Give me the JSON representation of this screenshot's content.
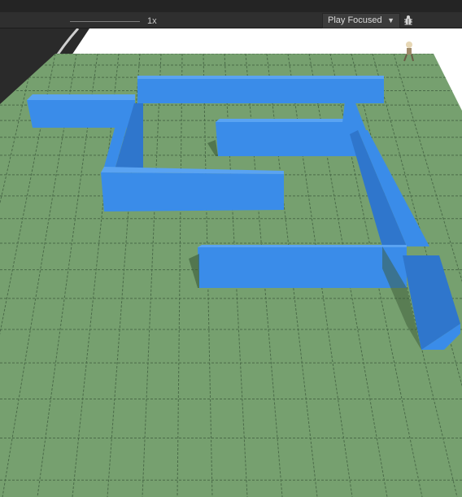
{
  "toolbar": {
    "scale_label": "1x",
    "play_mode": "Play Focused",
    "dropdown_icon": "triangle-down",
    "debug_icon": "bug-icon"
  },
  "scene": {
    "ground_color": "#76a06f",
    "wall_color": "#3586e4",
    "grid_line_color": "#4b6b49"
  }
}
